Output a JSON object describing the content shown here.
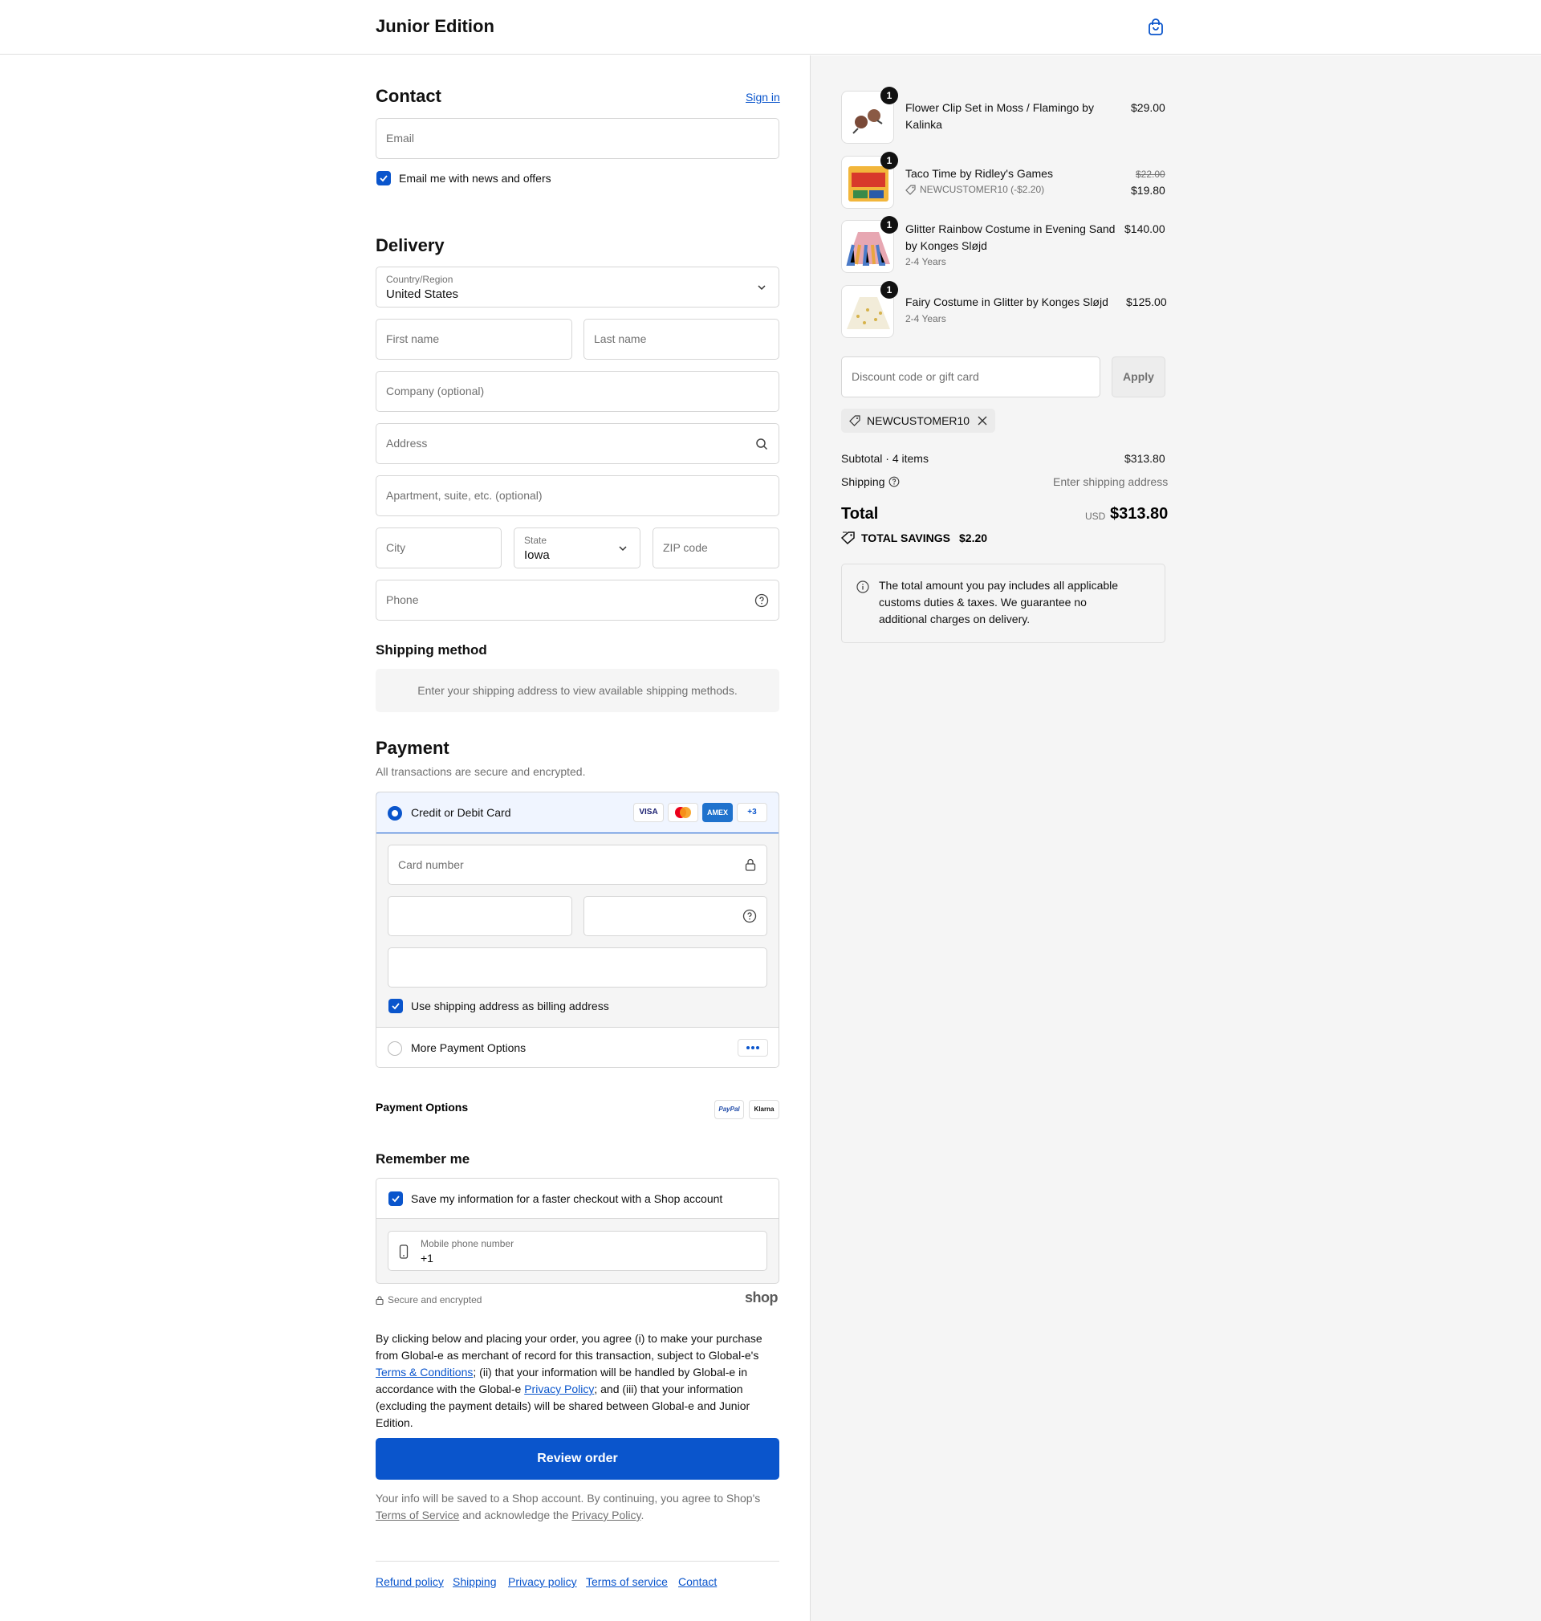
{
  "header": {
    "brand": "Junior Edition",
    "cart_icon": "shopping-bag-icon"
  },
  "contact": {
    "title": "Contact",
    "sign_in": "Sign in",
    "email_placeholder": "Email",
    "news_label": "Email me with news and offers"
  },
  "delivery": {
    "title": "Delivery",
    "country_label": "Country/Region",
    "country_value": "United States",
    "first_name": "First name",
    "last_name": "Last name",
    "company": "Company (optional)",
    "address": "Address",
    "apartment": "Apartment, suite, etc. (optional)",
    "city": "City",
    "state_label": "State",
    "state_value": "Iowa",
    "zip": "ZIP code",
    "phone": "Phone"
  },
  "shipping_method": {
    "title": "Shipping method",
    "message": "Enter your shipping address to view available shipping methods."
  },
  "payment": {
    "title": "Payment",
    "subtitle": "All transactions are secure and encrypted.",
    "card_option": "Credit or Debit Card",
    "card_logos": [
      "VISA",
      "",
      "AMEX",
      "+3"
    ],
    "card_number": "Card number",
    "billing_label": "Use shipping address as billing address",
    "more_options": "More Payment Options",
    "options_title": "Payment Options",
    "paypal": "PayPal",
    "klarna": "Klarna"
  },
  "remember": {
    "title": "Remember me",
    "save_label": "Save my information for a faster checkout with a Shop account",
    "mobile_label": "Mobile phone number",
    "mobile_value": "+1",
    "secure": "Secure and encrypted",
    "shop_logo": "shop"
  },
  "legal": {
    "p1": "By clicking below and placing your order, you agree (i) to make your purchase from Global-e as merchant of record for this transaction, subject to Global-e's ",
    "terms_link": "Terms & Conditions",
    "p2": "; (ii) that your information will be handled by Global-e in accordance with the Global-e ",
    "privacy_link": "Privacy Policy",
    "p3": "; and (iii) that your information (excluding the payment details) will be shared between Global-e and Junior Edition."
  },
  "review_button": "Review order",
  "shop_notice": {
    "p1": "Your info will be saved to a Shop account. By continuing, you agree to Shop's ",
    "tos": "Terms of Service",
    "p2": " and acknowledge the ",
    "privacy": "Privacy Policy",
    "p3": "."
  },
  "footer_links": [
    "Refund policy",
    "Shipping",
    "Privacy policy",
    "Terms of service",
    "Contact"
  ],
  "order": {
    "items": [
      {
        "qty": "1",
        "name_line1": "Flower Clip Set in Moss / Flamingo by",
        "name_line2": "Kalinka",
        "variant": "",
        "discount": "",
        "original_price": "",
        "price": "$29.00"
      },
      {
        "qty": "1",
        "name_line1": "Taco Time by Ridley's Games",
        "name_line2": "",
        "variant": "",
        "discount": "NEWCUSTOMER10 (-$2.20)",
        "original_price": "$22.00",
        "price": "$19.80"
      },
      {
        "qty": "1",
        "name_line1": "Glitter Rainbow Costume in Evening Sand",
        "name_line2": "by Konges Sløjd",
        "variant": "2-4 Years",
        "discount": "",
        "original_price": "",
        "price": "$140.00"
      },
      {
        "qty": "1",
        "name_line1": "Fairy Costume in Glitter by Konges Sløjd",
        "name_line2": "",
        "variant": "2-4 Years",
        "discount": "",
        "original_price": "",
        "price": "$125.00"
      }
    ],
    "discount_placeholder": "Discount code or gift card",
    "apply": "Apply",
    "applied_code": "NEWCUSTOMER10",
    "subtotal_label": "Subtotal · 4 items",
    "subtotal_value": "$313.80",
    "shipping_label": "Shipping",
    "shipping_value": "Enter shipping address",
    "total_label": "Total",
    "currency": "USD",
    "total_value": "$313.80",
    "savings_label": "TOTAL SAVINGS",
    "savings_value": "$2.20",
    "duties_note": "The total amount you pay includes all applicable customs duties & taxes. We guarantee no additional charges on delivery."
  },
  "colors": {
    "accent": "#0a55cc",
    "panel_bg": "#f5f5f5",
    "border": "#d6d6d6"
  }
}
